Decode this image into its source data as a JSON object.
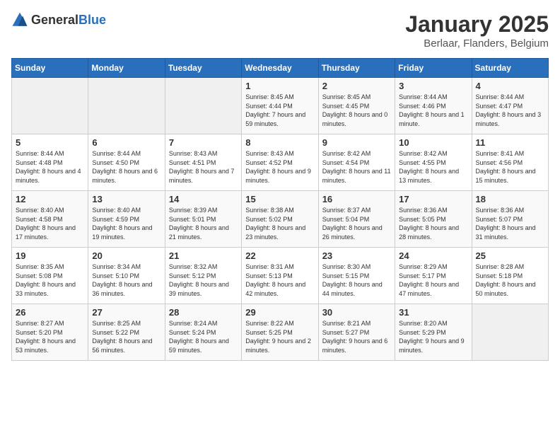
{
  "logo": {
    "general": "General",
    "blue": "Blue"
  },
  "title": "January 2025",
  "location": "Berlaar, Flanders, Belgium",
  "days_of_week": [
    "Sunday",
    "Monday",
    "Tuesday",
    "Wednesday",
    "Thursday",
    "Friday",
    "Saturday"
  ],
  "weeks": [
    [
      {
        "day": "",
        "empty": true
      },
      {
        "day": "",
        "empty": true
      },
      {
        "day": "",
        "empty": true
      },
      {
        "day": "1",
        "sunrise": "Sunrise: 8:45 AM",
        "sunset": "Sunset: 4:44 PM",
        "daylight": "Daylight: 7 hours and 59 minutes."
      },
      {
        "day": "2",
        "sunrise": "Sunrise: 8:45 AM",
        "sunset": "Sunset: 4:45 PM",
        "daylight": "Daylight: 8 hours and 0 minutes."
      },
      {
        "day": "3",
        "sunrise": "Sunrise: 8:44 AM",
        "sunset": "Sunset: 4:46 PM",
        "daylight": "Daylight: 8 hours and 1 minute."
      },
      {
        "day": "4",
        "sunrise": "Sunrise: 8:44 AM",
        "sunset": "Sunset: 4:47 PM",
        "daylight": "Daylight: 8 hours and 3 minutes."
      }
    ],
    [
      {
        "day": "5",
        "sunrise": "Sunrise: 8:44 AM",
        "sunset": "Sunset: 4:48 PM",
        "daylight": "Daylight: 8 hours and 4 minutes."
      },
      {
        "day": "6",
        "sunrise": "Sunrise: 8:44 AM",
        "sunset": "Sunset: 4:50 PM",
        "daylight": "Daylight: 8 hours and 6 minutes."
      },
      {
        "day": "7",
        "sunrise": "Sunrise: 8:43 AM",
        "sunset": "Sunset: 4:51 PM",
        "daylight": "Daylight: 8 hours and 7 minutes."
      },
      {
        "day": "8",
        "sunrise": "Sunrise: 8:43 AM",
        "sunset": "Sunset: 4:52 PM",
        "daylight": "Daylight: 8 hours and 9 minutes."
      },
      {
        "day": "9",
        "sunrise": "Sunrise: 8:42 AM",
        "sunset": "Sunset: 4:54 PM",
        "daylight": "Daylight: 8 hours and 11 minutes."
      },
      {
        "day": "10",
        "sunrise": "Sunrise: 8:42 AM",
        "sunset": "Sunset: 4:55 PM",
        "daylight": "Daylight: 8 hours and 13 minutes."
      },
      {
        "day": "11",
        "sunrise": "Sunrise: 8:41 AM",
        "sunset": "Sunset: 4:56 PM",
        "daylight": "Daylight: 8 hours and 15 minutes."
      }
    ],
    [
      {
        "day": "12",
        "sunrise": "Sunrise: 8:40 AM",
        "sunset": "Sunset: 4:58 PM",
        "daylight": "Daylight: 8 hours and 17 minutes."
      },
      {
        "day": "13",
        "sunrise": "Sunrise: 8:40 AM",
        "sunset": "Sunset: 4:59 PM",
        "daylight": "Daylight: 8 hours and 19 minutes."
      },
      {
        "day": "14",
        "sunrise": "Sunrise: 8:39 AM",
        "sunset": "Sunset: 5:01 PM",
        "daylight": "Daylight: 8 hours and 21 minutes."
      },
      {
        "day": "15",
        "sunrise": "Sunrise: 8:38 AM",
        "sunset": "Sunset: 5:02 PM",
        "daylight": "Daylight: 8 hours and 23 minutes."
      },
      {
        "day": "16",
        "sunrise": "Sunrise: 8:37 AM",
        "sunset": "Sunset: 5:04 PM",
        "daylight": "Daylight: 8 hours and 26 minutes."
      },
      {
        "day": "17",
        "sunrise": "Sunrise: 8:36 AM",
        "sunset": "Sunset: 5:05 PM",
        "daylight": "Daylight: 8 hours and 28 minutes."
      },
      {
        "day": "18",
        "sunrise": "Sunrise: 8:36 AM",
        "sunset": "Sunset: 5:07 PM",
        "daylight": "Daylight: 8 hours and 31 minutes."
      }
    ],
    [
      {
        "day": "19",
        "sunrise": "Sunrise: 8:35 AM",
        "sunset": "Sunset: 5:08 PM",
        "daylight": "Daylight: 8 hours and 33 minutes."
      },
      {
        "day": "20",
        "sunrise": "Sunrise: 8:34 AM",
        "sunset": "Sunset: 5:10 PM",
        "daylight": "Daylight: 8 hours and 36 minutes."
      },
      {
        "day": "21",
        "sunrise": "Sunrise: 8:32 AM",
        "sunset": "Sunset: 5:12 PM",
        "daylight": "Daylight: 8 hours and 39 minutes."
      },
      {
        "day": "22",
        "sunrise": "Sunrise: 8:31 AM",
        "sunset": "Sunset: 5:13 PM",
        "daylight": "Daylight: 8 hours and 42 minutes."
      },
      {
        "day": "23",
        "sunrise": "Sunrise: 8:30 AM",
        "sunset": "Sunset: 5:15 PM",
        "daylight": "Daylight: 8 hours and 44 minutes."
      },
      {
        "day": "24",
        "sunrise": "Sunrise: 8:29 AM",
        "sunset": "Sunset: 5:17 PM",
        "daylight": "Daylight: 8 hours and 47 minutes."
      },
      {
        "day": "25",
        "sunrise": "Sunrise: 8:28 AM",
        "sunset": "Sunset: 5:18 PM",
        "daylight": "Daylight: 8 hours and 50 minutes."
      }
    ],
    [
      {
        "day": "26",
        "sunrise": "Sunrise: 8:27 AM",
        "sunset": "Sunset: 5:20 PM",
        "daylight": "Daylight: 8 hours and 53 minutes."
      },
      {
        "day": "27",
        "sunrise": "Sunrise: 8:25 AM",
        "sunset": "Sunset: 5:22 PM",
        "daylight": "Daylight: 8 hours and 56 minutes."
      },
      {
        "day": "28",
        "sunrise": "Sunrise: 8:24 AM",
        "sunset": "Sunset: 5:24 PM",
        "daylight": "Daylight: 8 hours and 59 minutes."
      },
      {
        "day": "29",
        "sunrise": "Sunrise: 8:22 AM",
        "sunset": "Sunset: 5:25 PM",
        "daylight": "Daylight: 9 hours and 2 minutes."
      },
      {
        "day": "30",
        "sunrise": "Sunrise: 8:21 AM",
        "sunset": "Sunset: 5:27 PM",
        "daylight": "Daylight: 9 hours and 6 minutes."
      },
      {
        "day": "31",
        "sunrise": "Sunrise: 8:20 AM",
        "sunset": "Sunset: 5:29 PM",
        "daylight": "Daylight: 9 hours and 9 minutes."
      },
      {
        "day": "",
        "empty": true
      }
    ]
  ]
}
